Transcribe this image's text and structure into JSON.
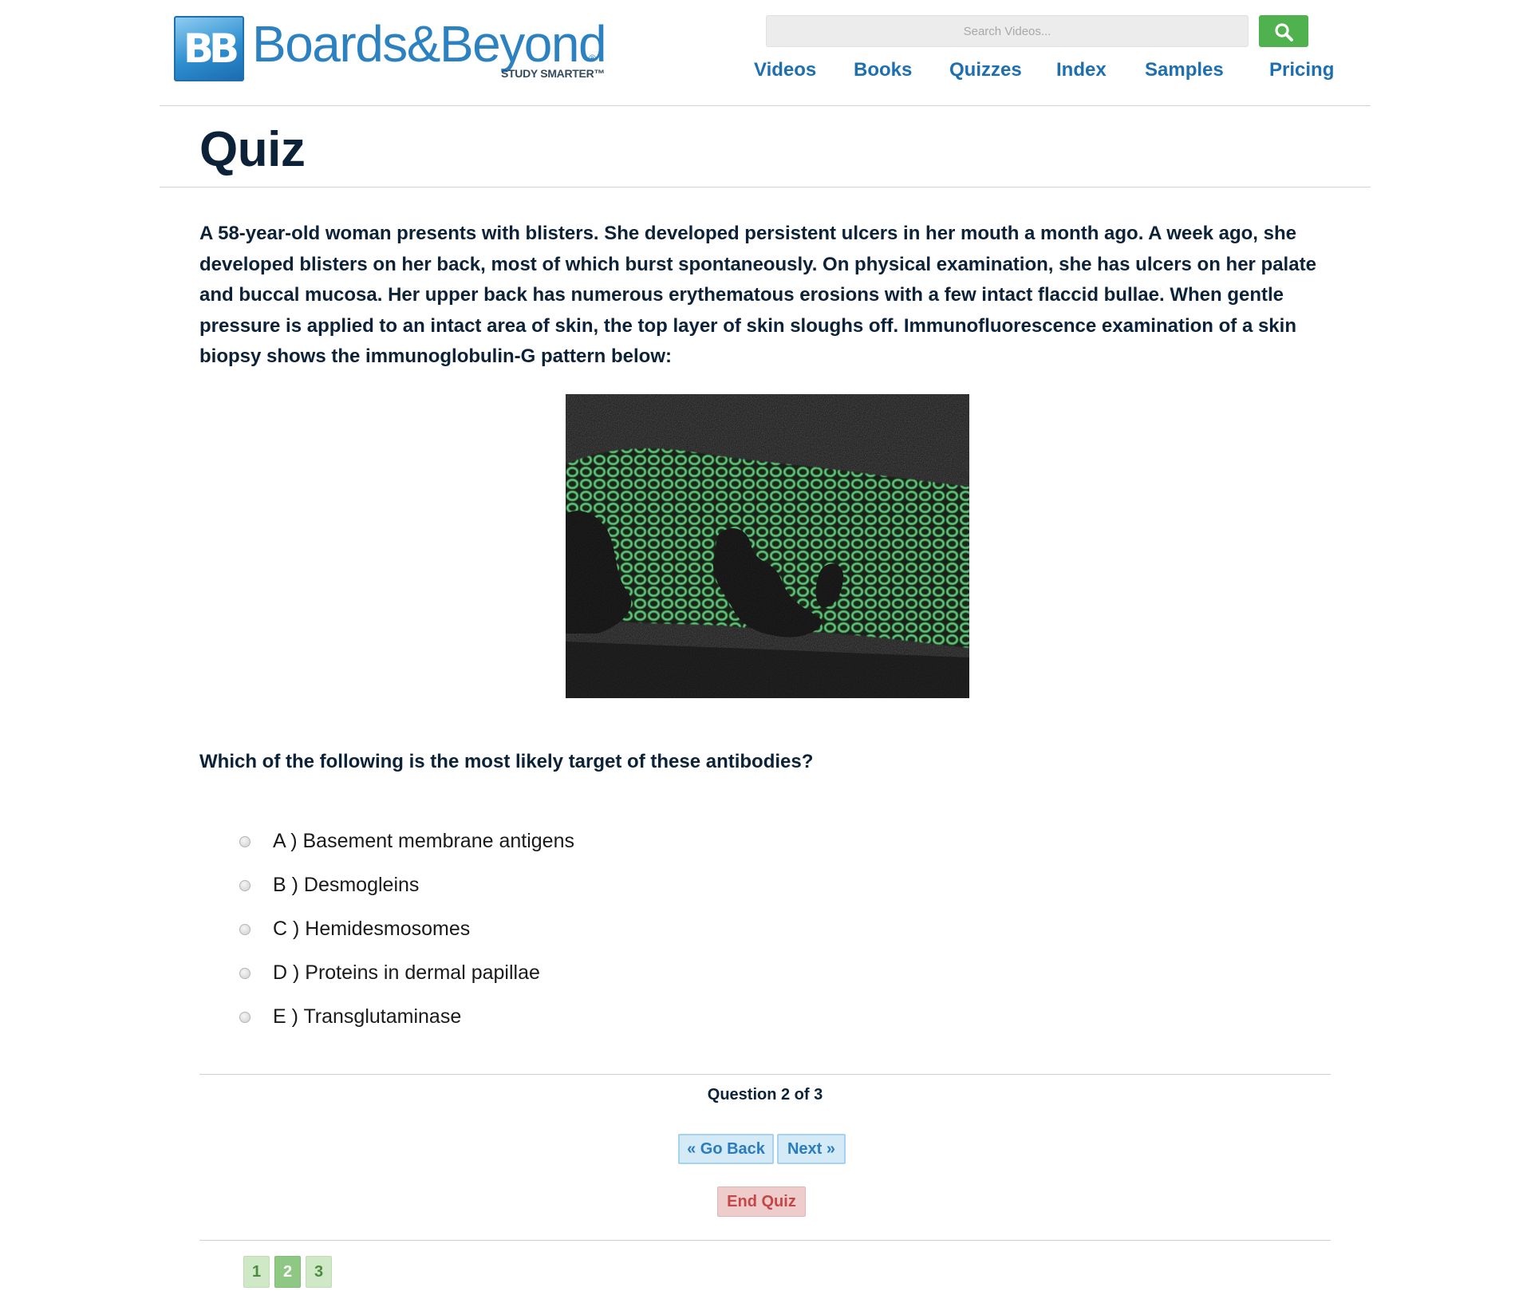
{
  "header": {
    "logo_badge": "BB",
    "logo_word": "Boards&Beyond",
    "logo_reg": "®",
    "logo_tagline": "STUDY SMARTER™",
    "search_placeholder": "Search Videos...",
    "search_icon": "search-icon",
    "nav": [
      "Videos",
      "Books",
      "Quizzes",
      "Index",
      "Samples",
      "Pricing"
    ]
  },
  "page_title": "Quiz",
  "question": {
    "stem": "A 58-year-old woman presents with blisters. She developed persistent ulcers in her mouth a month ago. A week ago, she developed blisters on her back, most of which burst spontaneously. On physical examination, she has ulcers on her palate and buccal mucosa. Her upper back has numerous erythematous erosions with a few intact flaccid bullae. When gentle pressure is applied to an intact area of skin, the top layer of skin sloughs off. Immunofluorescence examination of a skin biopsy shows the immunoglobulin-G pattern below:",
    "prompt": "Which of the following is the most likely target of these antibodies?",
    "options": [
      "A ) Basement membrane antigens",
      "B ) Desmogleins",
      "C ) Hemidesmosomes",
      "D ) Proteins in dermal papillae",
      "E ) Transglutaminase"
    ]
  },
  "quiz_nav": {
    "counter": "Question 2 of 3",
    "back_label": "« Go Back",
    "next_label": "Next »",
    "end_label": "End Quiz",
    "pages": [
      "1",
      "2",
      "3"
    ],
    "current_page": "2"
  },
  "colors": {
    "brand_blue": "#2c81c1",
    "nav_blue": "#1d6fb0",
    "search_green": "#4fb24f",
    "fluorescence_green": "#62e07c",
    "end_red": "#c54646"
  }
}
